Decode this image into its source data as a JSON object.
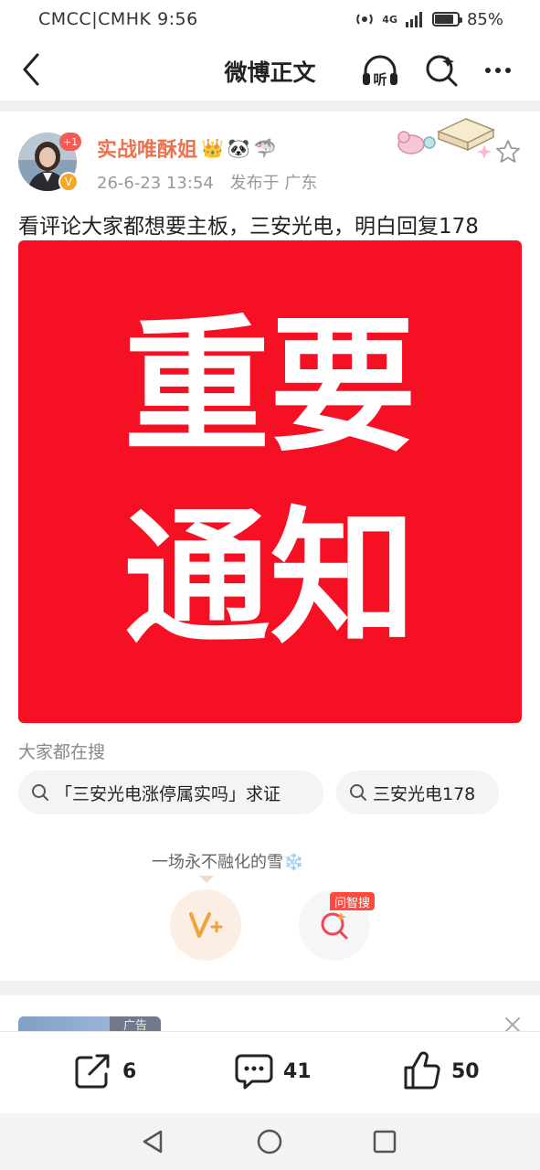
{
  "status_bar": {
    "carrier": "CMCC|CMHK",
    "time": "9:56",
    "network": "4G",
    "battery_percent": "85%",
    "battery_level": 0.85
  },
  "nav": {
    "title": "微博正文",
    "listen_label": "听",
    "icons": [
      "back-icon",
      "listen-icon",
      "search-icon",
      "more-icon"
    ]
  },
  "post": {
    "author_name": "实战唯酥姐",
    "avatar_badge": "+1",
    "timestamp": "26-6-23 13:54",
    "location": "发布于 广东",
    "text": "看评论大家都想要主板，三安光电，明白回复178",
    "image": {
      "line1": "重要",
      "line2": "通知",
      "background": "#f51023"
    },
    "author_emojis": [
      "👑",
      "🐼",
      "🦈"
    ]
  },
  "search": {
    "heading": "大家都在搜",
    "chips": [
      "「三安光电涨停属实吗」求证",
      "三安光电178"
    ]
  },
  "fan": {
    "label": "一场永不融化的雪❄️",
    "ask_tag": "问智搜"
  },
  "ad": {
    "label": "广告"
  },
  "actions": {
    "share_count": "6",
    "comment_count": "41",
    "like_count": "50"
  },
  "colors": {
    "accent": "#eb7350",
    "image_red": "#f51023",
    "divider": "#f0f0f0"
  }
}
